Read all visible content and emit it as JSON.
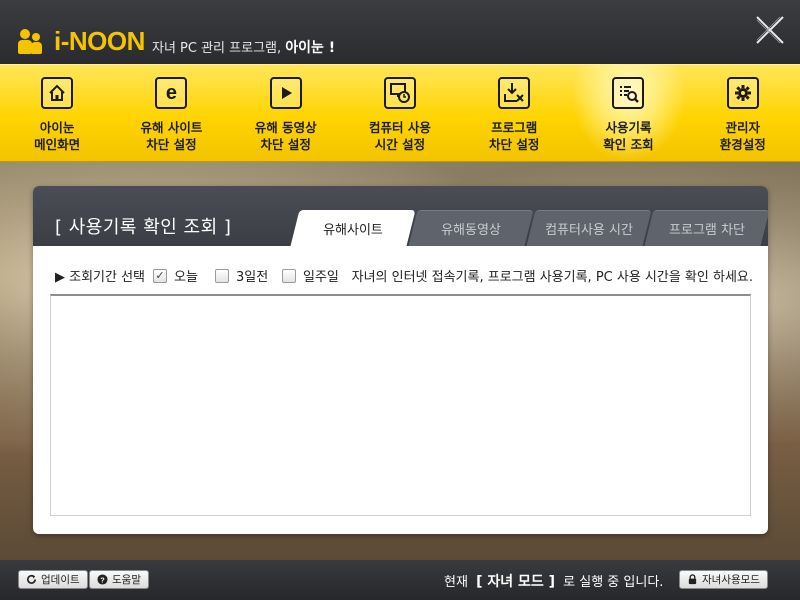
{
  "app": {
    "logo_text": "i-NOON",
    "tagline_prefix": "자녀 PC 관리 프로그램,",
    "tagline_brand": "아이눈 !"
  },
  "nav": [
    {
      "line1": "아이눈",
      "line2": "메인화면",
      "icon": "home-icon"
    },
    {
      "line1": "유해 사이트",
      "line2": "차단 설정",
      "icon": "browser-e-icon"
    },
    {
      "line1": "유해 동영상",
      "line2": "차단 설정",
      "icon": "play-icon"
    },
    {
      "line1": "컴퓨터 사용",
      "line2": "시간 설정",
      "icon": "monitor-clock-icon"
    },
    {
      "line1": "프로그램",
      "line2": "차단 설정",
      "icon": "download-block-icon"
    },
    {
      "line1": "사용기록",
      "line2": "확인 조회",
      "icon": "log-search-icon",
      "active": true
    },
    {
      "line1": "관리자",
      "line2": "환경설정",
      "icon": "gear-icon"
    }
  ],
  "panel": {
    "title": "[  사용기록 확인 조회  ]",
    "tabs": [
      "유해사이트",
      "유해동영상",
      "컴퓨터사용 시간",
      "프로그램 차단"
    ],
    "active_tab": "유해사이트",
    "filter_label": "▶ 조회기간 선택",
    "options": [
      {
        "label": "오늘",
        "checked": true
      },
      {
        "label": "3일전",
        "checked": false
      },
      {
        "label": "일주일",
        "checked": false
      }
    ],
    "description": "자녀의 인터넷 접속기록, 프로그램 사용기록, PC 사용 시간을 확인 하세요."
  },
  "footer": {
    "update_label": "업데이트",
    "help_label": "도움말",
    "status_prefix": "현재",
    "status_mode": "[ 자녀 모드 ]",
    "status_suffix": "로 실행 중 입니다.",
    "child_mode_label": "자녀사용모드"
  },
  "colors": {
    "accent_yellow": "#ffd400",
    "header_dark": "#2f3033",
    "panel_head": "#43464d"
  }
}
